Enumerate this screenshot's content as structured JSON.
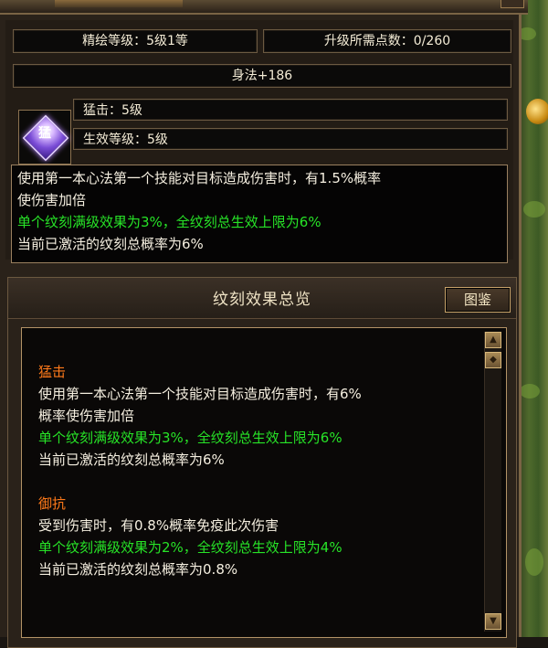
{
  "colors": {
    "panel_bg": "#2a221a",
    "text_white": "#f5efe0",
    "text_green": "#27e327",
    "text_orange": "#ff7a1a",
    "border_gold": "#9b8160"
  },
  "top": {
    "refine_level": "精绘等级：5级1等",
    "upgrade_points": "升级所需点数：0/260",
    "attribute": "身法+186",
    "skill_name": "猛击：5级",
    "effect_level": "生效等级：5级",
    "gem_char": "猛",
    "desc": {
      "line1": "使用第一本心法第一个技能对目标造成伤害时，有1.5%概率",
      "line2": "使伤害加倍",
      "line3": "单个纹刻满级效果为3%，全纹刻总生效上限为6%",
      "line4": "当前已激活的纹刻总概率为6%"
    }
  },
  "overview": {
    "title": "纹刻效果总览",
    "atlas_button": "图鉴",
    "entries": [
      {
        "name": "猛击",
        "line1": "使用第一本心法第一个技能对目标造成伤害时，有6%",
        "line2": "概率使伤害加倍",
        "limit": "单个纹刻满级效果为3%，全纹刻总生效上限为6%",
        "current": "当前已激活的纹刻总概率为6%"
      },
      {
        "name": "御抗",
        "line1": "受到伤害时，有0.8%概率免疫此次伤害",
        "limit": "单个纹刻满级效果为2%，全纹刻总生效上限为4%",
        "current": "当前已激活的纹刻总概率为0.8%"
      }
    ]
  },
  "icons": {
    "scroll_up": "scroll-up-icon",
    "scroll_thumb": "scroll-thumb-icon",
    "scroll_down": "scroll-down-icon",
    "gem": "purple-gem-icon"
  }
}
